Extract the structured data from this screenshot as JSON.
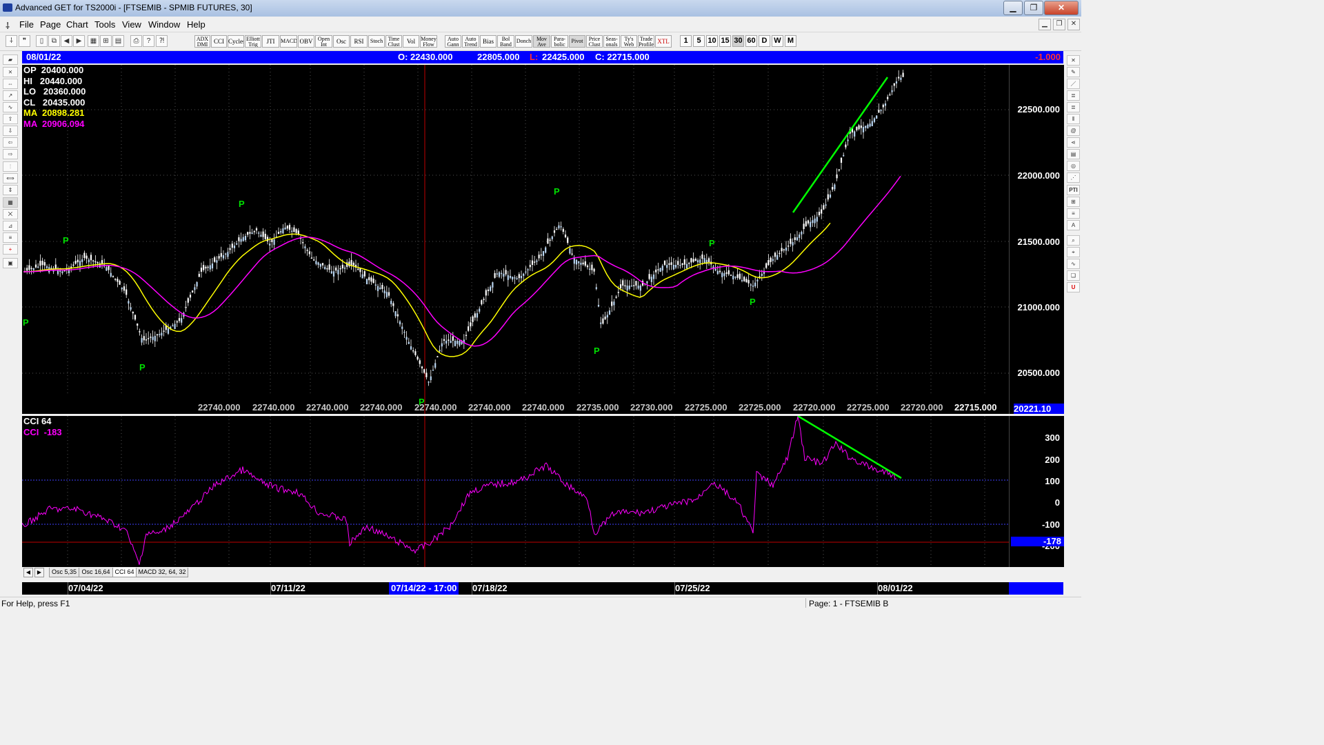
{
  "window": {
    "title": "Advanced GET for TS2000i - [FTSEMIB - SPMIB FUTURES, 30]",
    "min": "▁",
    "max": "❐",
    "close": "✕"
  },
  "menu": {
    "items": [
      "File",
      "Page",
      "Chart",
      "Tools",
      "View",
      "Window",
      "Help"
    ]
  },
  "toolbar": {
    "studies": [
      "ADX DMI",
      "CCI",
      "Cycles",
      "Elliott Trig",
      "JTI",
      "MACD",
      "OBV",
      "Open Int",
      "Osc",
      "RSI",
      "Stoch",
      "Time Clust",
      "Vol",
      "Money Flow",
      "Auto Gann",
      "Auto Trend",
      "Bias",
      "Bol Band",
      "Donch",
      "Mov Ave",
      "Para- bolic",
      "Pivot",
      "Price Clust",
      "Seas- onals",
      "Ty's Web",
      "Trade Profile",
      "XTL"
    ],
    "timeframes": [
      "1",
      "5",
      "10",
      "15",
      "30",
      "60",
      "D",
      "W",
      "M"
    ],
    "selected_timeframe": "30"
  },
  "header": {
    "date": "08/01/22",
    "open": "O: 22430.000",
    "high": "22805.000",
    "low_label": "L:",
    "low": "22425.000",
    "close": "C: 22715.000",
    "change": "-1.000"
  },
  "ohlc_box": {
    "op": "OP  20400.000",
    "hi": "HI   20440.000",
    "lo": "LO   20360.000",
    "cl": "CL   20435.000",
    "ma1": "MA  20898.281",
    "ma2": "MA  20906.094"
  },
  "price_axis": {
    "labels": [
      "22500.000",
      "22000.000",
      "21500.000",
      "21000.000",
      "20500.000"
    ],
    "cursor_value": "20221.10"
  },
  "bottom_values": [
    "22740.000",
    "22740.000",
    "22740.000",
    "22740.000",
    "22740.000",
    "22740.000",
    "22740.000",
    "22735.000",
    "22730.000",
    "22725.000",
    "22725.000",
    "22720.000",
    "22725.000",
    "22720.000"
  ],
  "last_value": "22715.000",
  "pivot_label": "P",
  "cci": {
    "title": "CCI 64",
    "value": "CCI  -183",
    "axis": [
      "300",
      "200",
      "100",
      "0",
      "-100",
      "-200"
    ],
    "cursor_value": "-178"
  },
  "tabs": [
    "Osc 5,35",
    "Osc 16,64",
    "CCI 64",
    "MACD 32, 64, 32"
  ],
  "tab_nav": [
    "◀",
    "▶"
  ],
  "dates": [
    "07/04/22",
    "07/11/22",
    "07/14/22 - 17:00",
    "07/18/22",
    "07/25/22",
    "08/01/22"
  ],
  "status": {
    "help": "For Help, press F1",
    "page": "Page: 1 - FTSEMIB B"
  },
  "colors": {
    "up_candle": "#b8d4f0",
    "ma_yellow": "#ffff00",
    "ma_magenta": "#ff00ff",
    "trend_green": "#00ff00",
    "cci_line": "#ff00ff",
    "header_blue": "#0000ff"
  }
}
